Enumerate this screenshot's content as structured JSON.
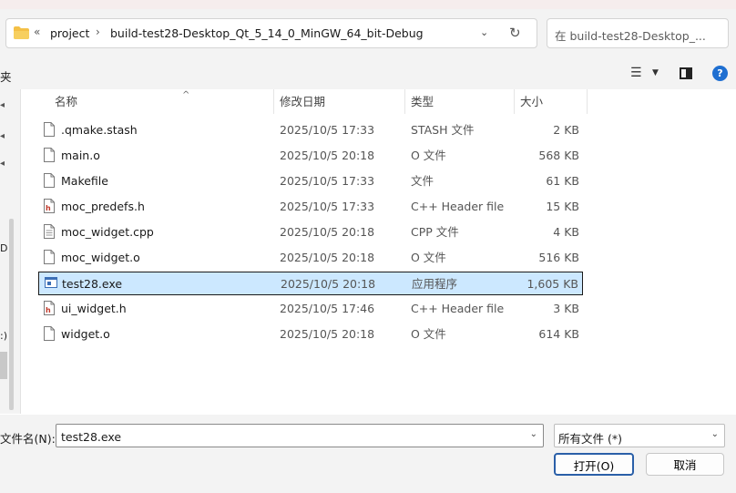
{
  "address": {
    "chevrons": "«",
    "crumbs": [
      "project",
      "build-test28-Desktop_Qt_5_14_0_MinGW_64_bit-Debug"
    ],
    "separator": "›"
  },
  "search": {
    "placeholder": "在 build-test28-Desktop_..."
  },
  "nav": {
    "left_label": "夹",
    "partials": [
      "D",
      ":)"
    ]
  },
  "columns": {
    "name": "名称",
    "date": "修改日期",
    "type": "类型",
    "size": "大小"
  },
  "files": [
    {
      "name": ".qmake.stash",
      "date": "2025/10/5 17:33",
      "type": "STASH 文件",
      "size": "2 KB",
      "icon": "document-icon"
    },
    {
      "name": "main.o",
      "date": "2025/10/5 20:18",
      "type": "O 文件",
      "size": "568 KB",
      "icon": "document-icon"
    },
    {
      "name": "Makefile",
      "date": "2025/10/5 17:33",
      "type": "文件",
      "size": "61 KB",
      "icon": "document-icon"
    },
    {
      "name": "moc_predefs.h",
      "date": "2025/10/5 17:33",
      "type": "C++ Header file",
      "size": "15 KB",
      "icon": "header-file-icon"
    },
    {
      "name": "moc_widget.cpp",
      "date": "2025/10/5 20:18",
      "type": "CPP 文件",
      "size": "4 KB",
      "icon": "text-file-icon"
    },
    {
      "name": "moc_widget.o",
      "date": "2025/10/5 20:18",
      "type": "O 文件",
      "size": "516 KB",
      "icon": "document-icon"
    },
    {
      "name": "test28.exe",
      "date": "2025/10/5 20:18",
      "type": "应用程序",
      "size": "1,605 KB",
      "icon": "executable-icon",
      "selected": true
    },
    {
      "name": "ui_widget.h",
      "date": "2025/10/5 17:46",
      "type": "C++ Header file",
      "size": "3 KB",
      "icon": "header-file-icon"
    },
    {
      "name": "widget.o",
      "date": "2025/10/5 20:18",
      "type": "O 文件",
      "size": "614 KB",
      "icon": "document-icon"
    }
  ],
  "footer": {
    "filename_label": "文件名(N):",
    "filename_value": "test28.exe",
    "filter_value": "所有文件 (*)",
    "open_label": "打开(O)",
    "cancel_label": "取消"
  },
  "colors": {
    "selected_bg": "#cce8ff",
    "accent": "#1f6fd1",
    "folder": "#f4c046"
  }
}
